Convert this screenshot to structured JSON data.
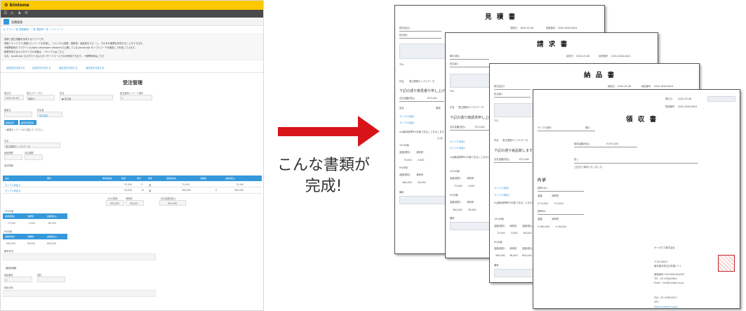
{
  "app": {
    "logo": "✿ kintone",
    "app_title": "見積管理",
    "breadcrumb": "≡ アプリ一覧 見積管理 › 一覧 見積書一覧 › レコード 4",
    "description": [
      "見積と受注書類を作成するアプリです。",
      "見積リストアプリ(見積)でレコードを作成し、リストから見積・見積書・納品書をコピーし、それぞれ帳票を作成することができます。",
      "※帳票使用のプラグイン(cybozu developer network)で公開している JavaScript サンプルコードを使用して作成しています。",
      "    帳票作成するカスタマイズの手順は、→サンプルはこちら",
      "    なお、JavaScript カスタマイズはスタンダードコースでのみ利用できます。   →帳票印刷はこちら"
    ],
    "actions": [
      "見積書を作成する",
      "請求書を作成する",
      "納品書を作成する",
      "領収書を作成する"
    ],
    "form_title": "受注管理",
    "fields_row1": {
      "labels": [
        "受注日",
        "受注ステータス",
        "担当",
        "受注番号/レコード番号"
      ],
      "values": [
        "2020-03-06",
        "見積中",
        "● 担当者",
        "4"
      ]
    },
    "customer": {
      "label": "顧客名",
      "value": "サンプル株式会社",
      "sub_label": "担当者",
      "sub_value": "担当者名"
    },
    "customer_buttons": [
      "顧客検索",
      "顧客情報取得"
    ],
    "customer_note": "→ 顧客をレコードから選んでください。",
    "subject": {
      "label": "件名",
      "value": "受注業務サンプルデータ"
    },
    "delivery_labels": [
      "納品期限",
      "支払期限"
    ],
    "detail_label": "品目明細",
    "table_headers": [
      "品名",
      "備考",
      "単価(税抜)",
      "数量",
      "単位",
      "税率",
      "金額(税抜)",
      "消費税",
      "金額(税込)"
    ],
    "table_rows": [
      [
        "サンプル商品 A",
        "",
        "",
        "25,000",
        "3",
        "個",
        "",
        "75,000",
        "",
        "75,000"
      ],
      [
        "サンプル商品 B",
        "",
        "",
        "56,000",
        "10",
        "個",
        "",
        "560,000",
        "0",
        "560,000"
      ]
    ],
    "totals_labels": [
      "小計(税抜)",
      "消費税",
      "合計金額(税込)"
    ],
    "totals_values": [
      "635,000",
      "56,000",
      "691,000"
    ],
    "tax10": {
      "label": "10%対象",
      "headers": [
        "金額(税抜)",
        "消費税",
        "金額(税込)"
      ],
      "values": [
        "75,000",
        "5,000",
        "80,000"
      ]
    },
    "tax8": {
      "label": "8%対象",
      "headers": [
        "金額(税抜)",
        "消費税",
        "金額(税込)"
      ],
      "values": [
        "560,000",
        "56,000",
        "604,000"
      ]
    },
    "remarks_label": "備考事項",
    "section_label": "【納品情報】",
    "footer_labels": [
      "納品番号",
      "送料",
      "納品日時"
    ],
    "footer_value": "4"
  },
  "caption": [
    "こんな書類が",
    "完成!"
  ],
  "documents": {
    "estimate": {
      "title": "見 積 書",
      "to_label": "株式会社1",
      "person_label": "担当者1",
      "date_label": "見積日",
      "date": "2020-03-06",
      "no_label": "見積番号",
      "no": "2020-0000-0001",
      "tel": "TEL:",
      "subject_label": "件名",
      "subject": "受注業務サンプルデータ",
      "message": "下記の通り御見積り申し上げます",
      "total_label": "合計金額(税込)",
      "total": "675,000",
      "items_header": [
        "品名",
        "単価"
      ],
      "items": [
        "サンプル商品1",
        "サンプル商品2"
      ],
      "note": "※は軽減税率8%対象であることを示します",
      "subtotal_label": "(小計",
      "tax10_label": "10%対象",
      "tax10_headers": [
        "金額(税抜)",
        "消費税"
      ],
      "tax10_values": [
        "75,000",
        "5,000"
      ],
      "tax8_label": "8%対象",
      "tax8_headers": [
        "金額(税抜)",
        "消費税"
      ],
      "tax8_values": [
        "560,000",
        "56,000"
      ],
      "remarks": "備考"
    },
    "invoice": {
      "title": "請 求 書",
      "to_label": "御中(株)1",
      "person_label": "担当者1",
      "date_label": "請求日",
      "date": "2020-03-06",
      "no_label": "請求番号",
      "no": "2020-0000-0001",
      "tel": "TEL:",
      "subject_label": "件名",
      "subject": "受注業務サンプルデータ",
      "message": "下記の通り御請求申し上げます",
      "total_label": "合計金額(税込)",
      "total": "675,000",
      "items": [
        "サンプル商品1",
        "サンプル商品2"
      ],
      "note": "※は軽減税率8%対象であることを示します",
      "tax10_label": "10%対象",
      "tax10_headers": [
        "金額(税抜)",
        "消費税"
      ],
      "tax10_values": [
        "75,000",
        "5,000"
      ],
      "tax8_label": "8%対象",
      "tax8_headers": [
        "金額(税抜)",
        "消費税"
      ],
      "tax8_values": [
        "560,000",
        "56,000"
      ],
      "remarks": "備考"
    },
    "delivery": {
      "title": "納 品 書",
      "to_label": "株式会社1",
      "person_label": "担当者1",
      "date_label": "納品日",
      "date": "2020-03-06",
      "no_label": "納品番号",
      "no": "2020-0000-0001",
      "tel": "TEL:",
      "subject_label": "件名",
      "subject": "受注業務サンプルデータ",
      "message": "下記の通り納品致します",
      "total_label": "合計金額(税込)",
      "total": "675,000",
      "items": [
        "サンプル商品1",
        "サンプル商品2"
      ],
      "note": "※は軽減税率8%対象であることを示します",
      "tax10_label": "10%対象",
      "tax10_headers": [
        "金額(税抜)",
        "消費税",
        "金額(税込)"
      ],
      "tax10_values": [
        "75,000",
        "5,000",
        "80,000"
      ],
      "tax8_label": "8%対象",
      "tax8_headers": [
        "金額(税抜)",
        "消費税",
        "金額(税込)"
      ],
      "tax8_values": [
        "560,000",
        "56,000",
        "604,000"
      ],
      "remarks": "備考"
    },
    "receipt": {
      "title": "領 収 書",
      "date_label": "発行日",
      "date": "2020-03-06",
      "no_label": "受領番号",
      "no": "2020-0000-0001",
      "to_label": "サンプル御中",
      "honorific": "御中",
      "amount_label": "領収金額(税込)",
      "amount": "¥ 675,000",
      "tadashi": "但し",
      "received": "上記正に領収いたしました。",
      "breakdown_label": "内 訳",
      "tax10_label": "税率10%",
      "tax10_headers": [
        "金額",
        "消費税"
      ],
      "tax10_values": [
        "¥ 75,000",
        "¥ 5,000"
      ],
      "tax8_label": "税率8%",
      "tax8_headers": [
        "金額",
        "消費税"
      ],
      "tax8_values": [
        "¥ 560,000",
        "¥ 56,000"
      ],
      "company": "サイボウズ株式会社",
      "address": [
        "〒103-6047",
        "東京都中央区日本橋2-7-1"
      ],
      "contact": [
        "登録番号:T1010001004567",
        "TEL : 03-4306-0800",
        "Email : info@cybozu.co.jp"
      ],
      "fax": [
        "FAX : 03-4306-0811",
        "URL :",
        "https://cybozu.co.jp/"
      ]
    }
  },
  "colors": {
    "kintone_yellow": "#fcc800",
    "kintone_blue": "#3498db",
    "arrow_red": "#d7141a"
  }
}
